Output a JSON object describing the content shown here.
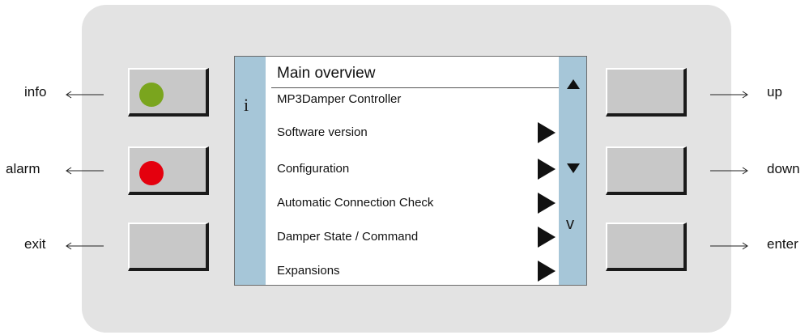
{
  "left_buttons": [
    {
      "label": "info",
      "led": "green-led-icon",
      "led_color": "#7aa51e"
    },
    {
      "label": "alarm",
      "led": "red-led-icon",
      "led_color": "#e4000e"
    },
    {
      "label": "exit"
    }
  ],
  "right_buttons": [
    {
      "label": "up"
    },
    {
      "label": "down"
    },
    {
      "label": "enter"
    }
  ],
  "screen": {
    "title": "Main overview",
    "subtitle": "MP3Damper Controller",
    "info_glyph": "i",
    "side_glyph": "v",
    "menu_items": [
      {
        "label": "Software version"
      },
      {
        "label": "Configuration"
      },
      {
        "label": "Automatic Connection Check"
      },
      {
        "label": "Damper State / Command"
      },
      {
        "label": "Expansions"
      }
    ]
  },
  "colors": {
    "panel": "#e3e3e3",
    "screen_bar": "#a6c6d8",
    "button_face": "#c8c8c8"
  }
}
